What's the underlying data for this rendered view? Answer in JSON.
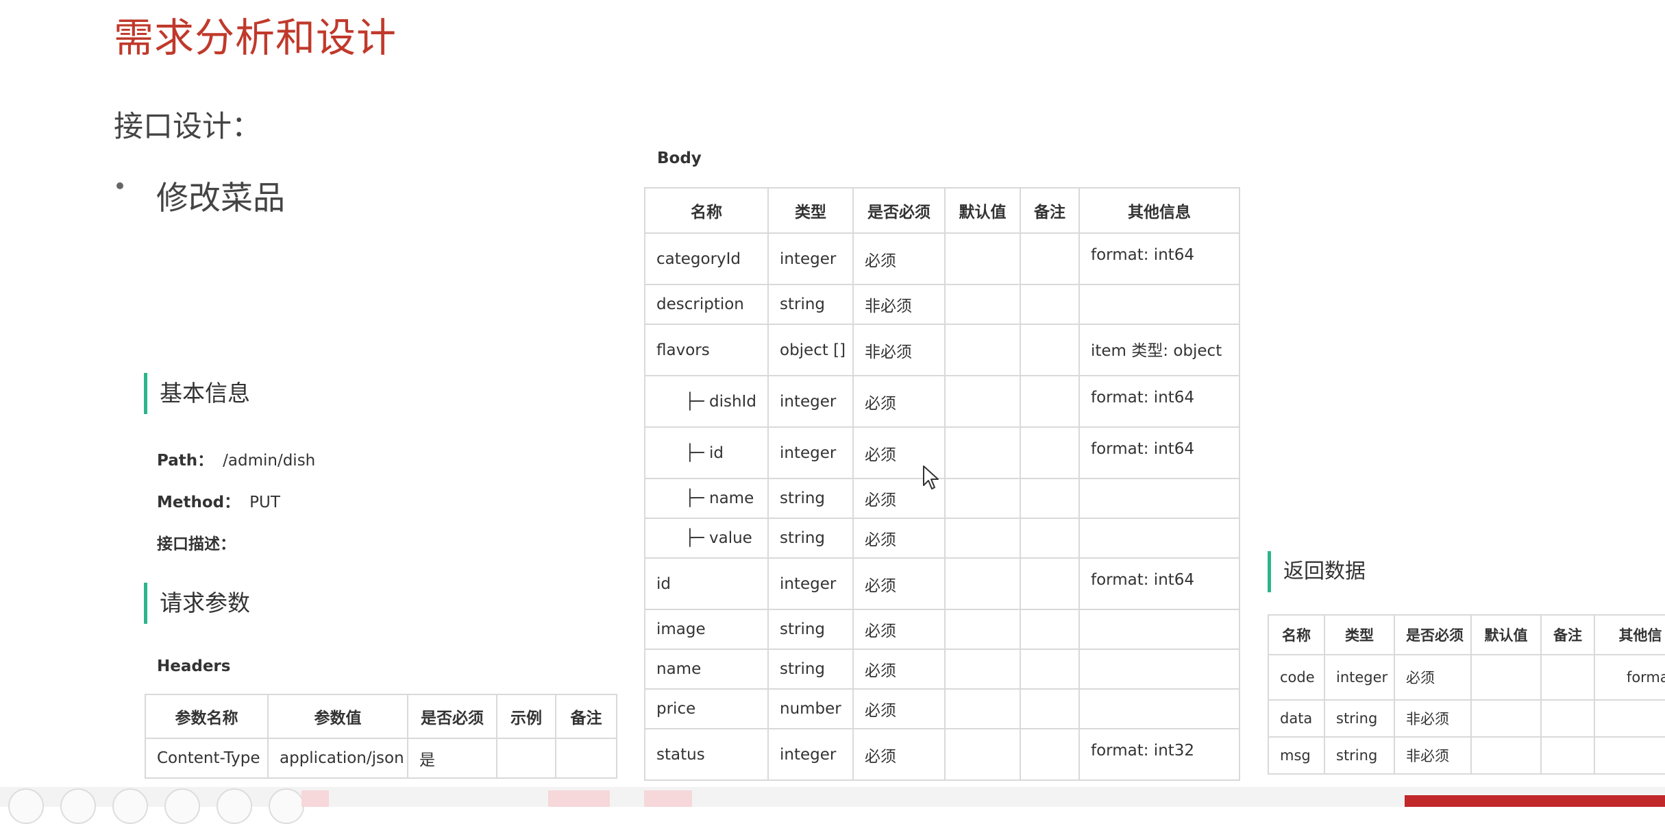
{
  "slide": {
    "title": "需求分析和设计",
    "subtitle": "接口设计：",
    "bullet": "修改菜品"
  },
  "basic": {
    "heading": "基本信息",
    "path_label": "Path：",
    "path_value": "/admin/dish",
    "method_label": "Method：",
    "method_value": "PUT",
    "desc_label": "接口描述："
  },
  "request": {
    "heading": "请求参数",
    "headers_label": "Headers",
    "headers_table": {
      "columns": [
        "参数名称",
        "参数值",
        "是否必须",
        "示例",
        "备注"
      ],
      "rows": [
        [
          "Content-Type",
          "application/json",
          "是",
          "",
          ""
        ]
      ]
    }
  },
  "body": {
    "label": "Body",
    "columns": [
      "名称",
      "类型",
      "是否必须",
      "默认值",
      "备注",
      "其他信息"
    ],
    "rows": [
      {
        "name": "categoryId",
        "type": "integer",
        "required": "必须",
        "default": "",
        "note": "",
        "other": "format: int64"
      },
      {
        "name": "description",
        "type": "string",
        "required": "非必须",
        "default": "",
        "note": "",
        "other": ""
      },
      {
        "name": "flavors",
        "type": "object []",
        "required": "非必须",
        "default": "",
        "note": "",
        "other": "item 类型: object"
      },
      {
        "name": "├─ dishId",
        "type": "integer",
        "required": "必须",
        "default": "",
        "note": "",
        "other": "format: int64"
      },
      {
        "name": "├─ id",
        "type": "integer",
        "required": "必须",
        "default": "",
        "note": "",
        "other": "format: int64"
      },
      {
        "name": "├─ name",
        "type": "string",
        "required": "必须",
        "default": "",
        "note": "",
        "other": ""
      },
      {
        "name": "├─ value",
        "type": "string",
        "required": "必须",
        "default": "",
        "note": "",
        "other": ""
      },
      {
        "name": "id",
        "type": "integer",
        "required": "必须",
        "default": "",
        "note": "",
        "other": "format: int64"
      },
      {
        "name": "image",
        "type": "string",
        "required": "必须",
        "default": "",
        "note": "",
        "other": ""
      },
      {
        "name": "name",
        "type": "string",
        "required": "必须",
        "default": "",
        "note": "",
        "other": ""
      },
      {
        "name": "price",
        "type": "number",
        "required": "必须",
        "default": "",
        "note": "",
        "other": ""
      },
      {
        "name": "status",
        "type": "integer",
        "required": "必须",
        "default": "",
        "note": "",
        "other": "format: int32"
      }
    ]
  },
  "response": {
    "heading": "返回数据",
    "columns": [
      "名称",
      "类型",
      "是否必须",
      "默认值",
      "备注",
      "其他信"
    ],
    "rows": [
      {
        "name": "code",
        "type": "integer",
        "required": "必须",
        "default": "",
        "note": "",
        "other": "format"
      },
      {
        "name": "data",
        "type": "string",
        "required": "非必须",
        "default": "",
        "note": "",
        "other": ""
      },
      {
        "name": "msg",
        "type": "string",
        "required": "非必须",
        "default": "",
        "note": "",
        "other": ""
      }
    ]
  },
  "colors": {
    "title_red": "#c0392b",
    "accent_green": "#2bb58a",
    "border": "#d9d9d9"
  }
}
